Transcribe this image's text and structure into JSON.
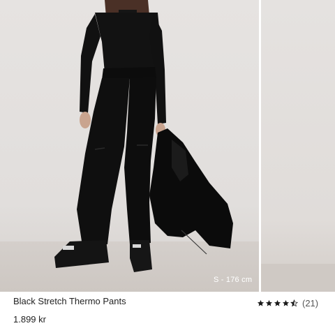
{
  "product": {
    "title": "Black Stretch Thermo Pants",
    "price": "1.899 kr",
    "rating": 4.5,
    "rating_max": 5,
    "review_count": "(21)"
  },
  "image": {
    "size_caption": "S - 176 cm"
  },
  "colors": {
    "garment": "#0e0e0e",
    "background": "#e3e0de",
    "text": "#222222"
  }
}
